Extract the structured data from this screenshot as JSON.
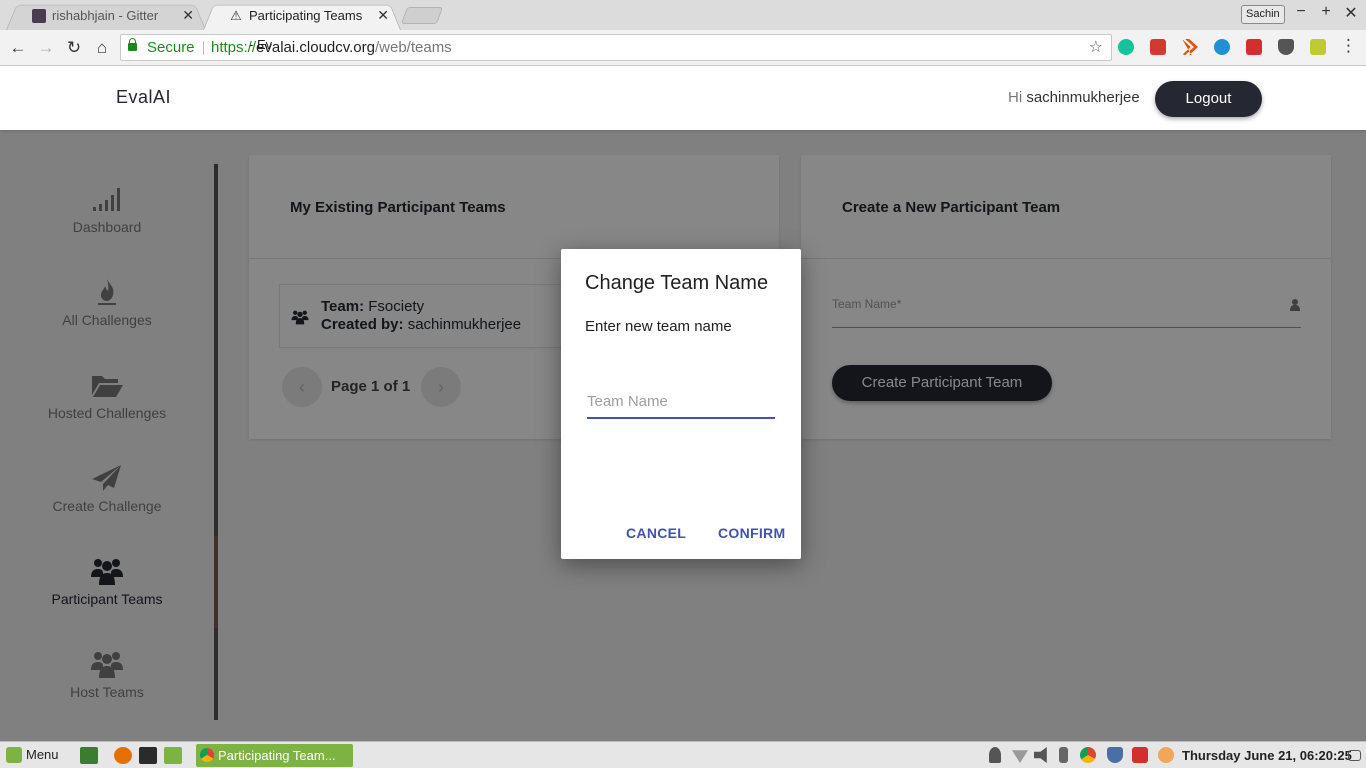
{
  "browser": {
    "tabs": [
      {
        "title": "rishabhjain - Gitter",
        "active": false
      },
      {
        "title": "Participating Teams - Ev",
        "active": true
      }
    ],
    "profile": "Sachin",
    "secure_label": "Secure",
    "url": {
      "scheme": "https://",
      "host": "evalai.cloudcv.org",
      "path": "/web/teams"
    }
  },
  "header": {
    "logo": "EvalAI",
    "greeting": "Hi",
    "username": "sachinmukherjee",
    "logout": "Logout"
  },
  "sidebar": {
    "items": [
      {
        "label": "Dashboard",
        "icon": "signal-bars-icon",
        "active": false
      },
      {
        "label": "All Challenges",
        "icon": "fire-icon",
        "active": false
      },
      {
        "label": "Hosted Challenges",
        "icon": "folder-open-icon",
        "active": false
      },
      {
        "label": "Create Challenge",
        "icon": "paper-plane-icon",
        "active": false
      },
      {
        "label": "Participant Teams",
        "icon": "users-icon",
        "active": true
      },
      {
        "label": "Host Teams",
        "icon": "users-icon",
        "active": false
      }
    ]
  },
  "existing_teams": {
    "title": "My Existing Participant Teams",
    "team_label": "Team:",
    "team_name": "Fsociety",
    "created_by_label": "Created by:",
    "created_by": "sachinmukherjee",
    "pagination": "Page 1 of 1"
  },
  "create_team": {
    "title": "Create a New Participant Team",
    "field_label": "Team Name*",
    "button": "Create Participant Team"
  },
  "dialog": {
    "title": "Change Team Name",
    "prompt": "Enter new team name",
    "input_placeholder": "Team Name",
    "input_value": "",
    "cancel": "CANCEL",
    "confirm": "CONFIRM"
  },
  "taskbar": {
    "menu": "Menu",
    "task": "Participating Team...",
    "clock": "Thursday June 21, 06:20:25"
  },
  "colors": {
    "brand_dark": "#252833",
    "dialog_accent": "#3f51b5",
    "secure_green": "#1a8a1a"
  }
}
